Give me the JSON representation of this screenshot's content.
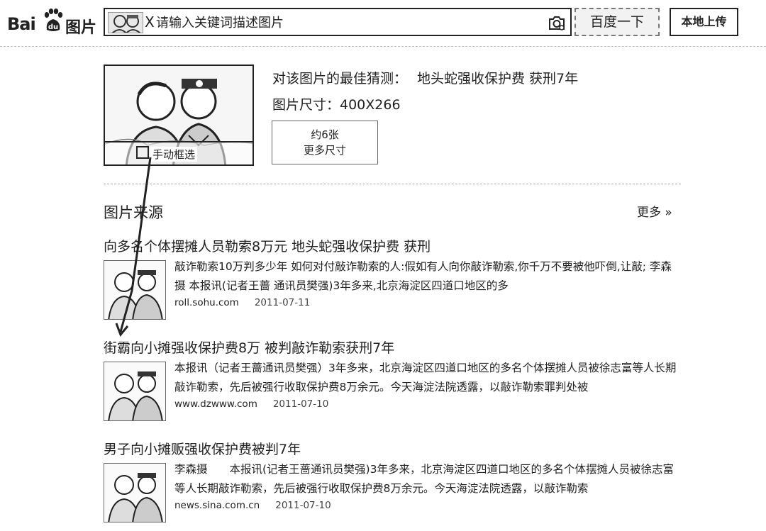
{
  "header": {
    "logo_bai": "Bai",
    "logo_tupian": "图片",
    "chip_close": "X",
    "search_placeholder": "请输入关键词描述图片",
    "search_button": "百度一下",
    "upload_button": "本地上传"
  },
  "query": {
    "crop_label": "手动框选",
    "guess_label": "对该图片的最佳猜测：",
    "guess_value": "地头蛇强收保护费 获刑7年",
    "size_text": "图片尺寸：400X266",
    "more_sizes_count": "约6张",
    "more_sizes_label": "更多尺寸"
  },
  "sources": {
    "title": "图片来源",
    "more": "更多 »"
  },
  "results": [
    {
      "title": "向多名个体摆摊人员勒索8万元 地头蛇强收保护费 获刑",
      "snippet": "敲诈勒索10万判多少年 如何对付敲诈勒索的人:假如有人向你敲诈勒索,你千万不要被他吓倒,让敲; 李森 摄 本报讯(记者王蔷 通讯员樊强)3年多来,北京海淀区四道口地区的多",
      "domain": "roll.sohu.com",
      "date": "2011-07-11"
    },
    {
      "title": "街霸向小摊强收保护费8万 被判敲诈勒索获刑7年",
      "snippet": "本报讯（记者王蔷通讯员樊强）3年多来，北京海淀区四道口地区的多名个体摆摊人员被徐志富等人长期敲诈勒索，先后被强行收取保护费8万余元。今天海淀法院透露，以敲诈勒索罪判处被",
      "domain": "www.dzwww.com",
      "date": "2011-07-10"
    },
    {
      "title": "男子向小摊贩强收保护费被判7年",
      "snippet": "李森摄　　本报讯(记者王蔷通讯员樊强)3年多来，北京海淀区四道口地区的多名个体摆摊人员被徐志富等人长期敲诈勒索，先后被强行收取保护费8万余元。今天海淀法院透露，以敲诈勒索",
      "domain": "news.sina.com.cn",
      "date": "2011-07-10"
    }
  ]
}
